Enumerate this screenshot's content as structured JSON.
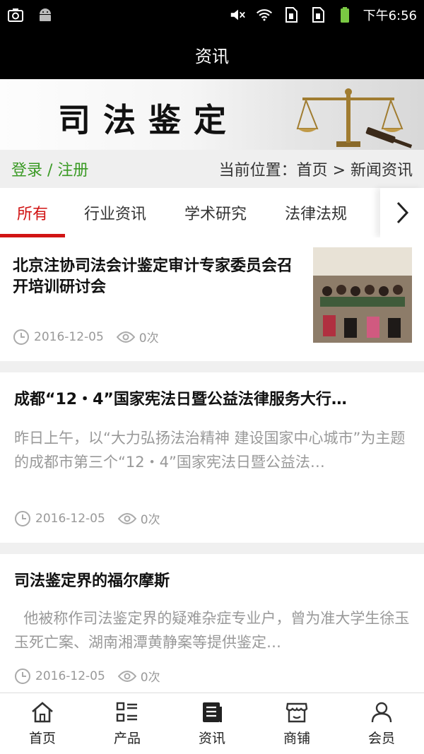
{
  "statusbar": {
    "time": "下午6:56",
    "icons_left": [
      "screenshot-icon",
      "android-icon"
    ],
    "icons_right": [
      "mute-icon",
      "wifi-icon",
      "sim1-icon",
      "sim2-icon",
      "battery-icon"
    ]
  },
  "appbar": {
    "title": "资讯"
  },
  "banner": {
    "title": "司法鉴定"
  },
  "locbar": {
    "login": "登录 / 注册",
    "location": "当前位置：首页 > 新闻资讯"
  },
  "tabs": [
    "所有",
    "行业资讯",
    "学术研究",
    "法律法规"
  ],
  "articles": [
    {
      "title": "北京注协司法会计鉴定审计专家委员会召开培训研讨会",
      "date": "2016-12-05",
      "views": "0次"
    },
    {
      "title": "成都“12・4”国家宪法日暨公益法律服务大行…",
      "summary": "昨日上午，以“大力弘扬法治精神 建设国家中心城市”为主题的成都市第三个“12・4”国家宪法日暨公益法…",
      "date": "2016-12-05",
      "views": "0次"
    },
    {
      "title": "司法鉴定界的福尔摩斯",
      "summary": "  他被称作司法鉴定界的疑难杂症专业户，曾为准大学生徐玉玉死亡案、湖南湘潭黄静案等提供鉴定…",
      "date": "2016-12-05",
      "views": "0次"
    }
  ],
  "bottomnav": [
    {
      "label": "首页",
      "icon": "home-icon"
    },
    {
      "label": "产品",
      "icon": "grid-list-icon"
    },
    {
      "label": "资讯",
      "icon": "news-icon"
    },
    {
      "label": "商铺",
      "icon": "shop-icon"
    },
    {
      "label": "会员",
      "icon": "user-icon"
    }
  ],
  "colors": {
    "accent": "#d11414",
    "login_green": "#3a9a24"
  }
}
